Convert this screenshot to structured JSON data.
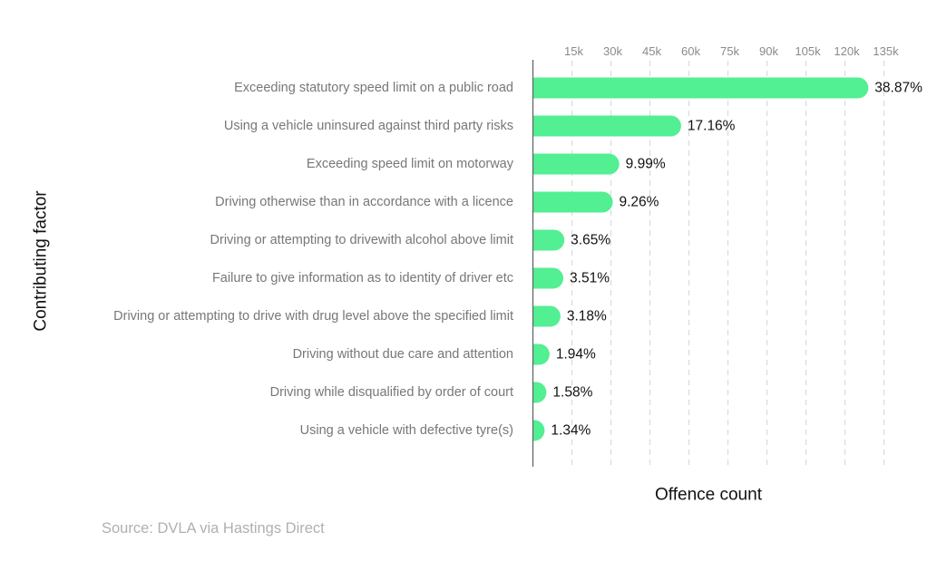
{
  "chart_data": {
    "type": "bar",
    "orientation": "horizontal",
    "title": "",
    "xlabel": "Offence count",
    "ylabel": "Contributing factor",
    "xlim": [
      0,
      135000
    ],
    "x_ticks": [
      15000,
      30000,
      45000,
      60000,
      75000,
      90000,
      105000,
      120000,
      135000
    ],
    "x_tick_labels": [
      "15k",
      "30k",
      "45k",
      "60k",
      "75k",
      "90k",
      "105k",
      "120k",
      "135k"
    ],
    "grid": true,
    "bar_color": "#52EF93",
    "categories": [
      "Exceeding statutory speed limit on a public road",
      "Using a vehicle uninsured against third party risks",
      "Exceeding speed limit on motorway",
      "Driving otherwise than in accordance with a licence",
      "Driving or attempting to drivewith alcohol above limit",
      "Failure to give information as to identity of driver etc",
      "Driving or attempting to drive with drug level above the specified limit",
      "Driving without due care and attention",
      "Driving while disqualified by order of court",
      "Using a vehicle with defective tyre(s)"
    ],
    "values": [
      129000,
      57000,
      33200,
      30700,
      12100,
      11700,
      10600,
      6400,
      5200,
      4500
    ],
    "value_labels": [
      "38.87%",
      "17.16%",
      "9.99%",
      "9.26%",
      "3.65%",
      "3.51%",
      "3.18%",
      "1.94%",
      "1.58%",
      "1.34%"
    ],
    "source": "Source: DVLA via Hastings Direct"
  }
}
